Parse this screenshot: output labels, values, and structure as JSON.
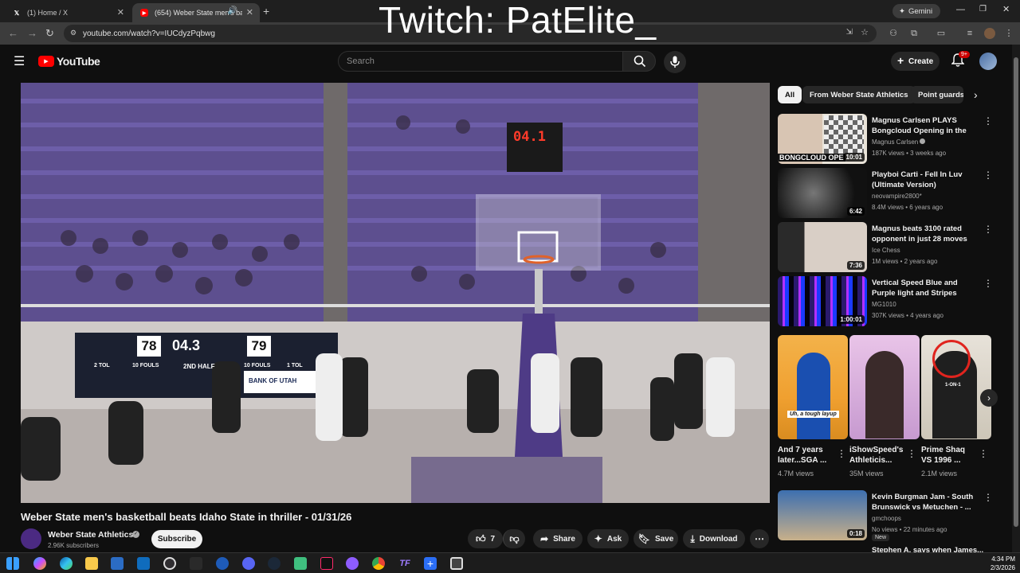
{
  "browser": {
    "tabs": [
      {
        "label": "(1) Home / X",
        "icon": "x-logo-icon"
      },
      {
        "label": "(654) Weber State men's ba",
        "icon": "youtube-icon"
      }
    ],
    "url": "youtube.com/watch?v=IUCdyzPqbwg",
    "gemini_label": "Gemini"
  },
  "overlay_text": "Twitch: PatElite_",
  "youtube": {
    "logo_text": "YouTube",
    "search_placeholder": "Search",
    "create_label": "Create",
    "notification_badge": "9+"
  },
  "video": {
    "scoreboard": {
      "home": "78",
      "clock": "04.3",
      "away": "79",
      "shot_clock": "04.1",
      "half": "2ND HALF",
      "home_fouls": "10 FOULS",
      "away_fouls": "10 FOULS",
      "home_tol": "2 TOL",
      "away_tol": "1 TOL",
      "sponsor": "BANK OF UTAH"
    },
    "title": "Weber State men's basketball beats Idaho State in thriller - 01/31/26",
    "channel": "Weber State Athletics",
    "subscribers": "2.96K subscribers",
    "subscribe_label": "Subscribe",
    "likes": "7",
    "share_label": "Share",
    "ask_label": "Ask",
    "save_label": "Save",
    "download_label": "Download"
  },
  "chips": [
    "All",
    "From Weber State Athletics",
    "Point guards"
  ],
  "recommendations": [
    {
      "title": "Magnus Carlsen PLAYS Bongcloud Opening in the FIR...",
      "channel": "Magnus Carlsen",
      "meta": "187K views • 3 weeks ago",
      "duration": "10:01",
      "thumb_text": "BONGCLOUD OPE"
    },
    {
      "title": "Playboi Carti - Fell In Luv (Ultimate Version)",
      "channel": "neovampire2800*",
      "meta": "8.4M views • 6 years ago",
      "duration": "6:42"
    },
    {
      "title": "Magnus beats 3100 rated opponent in just 28 moves",
      "channel": "Ice Chess",
      "meta": "1M views • 2 years ago",
      "duration": "7:36"
    },
    {
      "title": "Vertical Speed Blue and Purple light and Stripes Background ...",
      "channel": "MG1010",
      "meta": "307K views • 4 years ago",
      "duration": "1:00:01"
    }
  ],
  "shorts": [
    {
      "title": "And 7 years later...SGA ...",
      "views": "4.7M views",
      "caption": "Uh, a tough layup"
    },
    {
      "title": "iShowSpeed's Athleticis...",
      "views": "35M views"
    },
    {
      "title": "Prime Shaq VS 1996 ...",
      "views": "2.1M views",
      "caption": "1-ON-1"
    }
  ],
  "recommendation_last": {
    "title": "Kevin Burgman Jam - South Brunswick vs Metuchen - ...",
    "channel": "gmchoops",
    "meta": "No views • 22 minutes ago",
    "badge": "New",
    "duration": "0:18",
    "next_title": "Stephen A. says when James..."
  },
  "taskbar": {
    "time": "4:34 PM",
    "date": "2/3/2026"
  }
}
